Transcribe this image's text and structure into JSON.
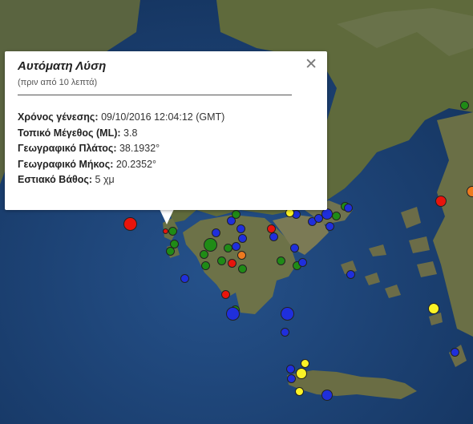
{
  "popup": {
    "title": "Αυτόματη Λύση",
    "subtitle": "(πριν από 10 λεπτά)",
    "close_icon": "close-icon",
    "rows": [
      {
        "label": "Χρόνος γένεσης:",
        "value": " 09/10/2016  12:04:12 (GMT)"
      },
      {
        "label": "Τοπικό Μέγεθος (ML):",
        "value": " 3.8"
      },
      {
        "label": "Γεωγραφικό Πλάτος:",
        "value": " 38.1932°"
      },
      {
        "label": "Γεωγραφικό Μήκος:",
        "value": " 20.2352°"
      },
      {
        "label": "Εστιακό Βάθος:",
        "value": " 5 χμ"
      }
    ]
  },
  "legend_colors": {
    "red": "#e8140c",
    "orange": "#ee7a1f",
    "yellow": "#fbf326",
    "green": "#1f8b16",
    "blue": "#1f2fdc"
  },
  "map": {
    "land_color": "#5f6a3c",
    "sea_color": "#1c3e6e"
  }
}
